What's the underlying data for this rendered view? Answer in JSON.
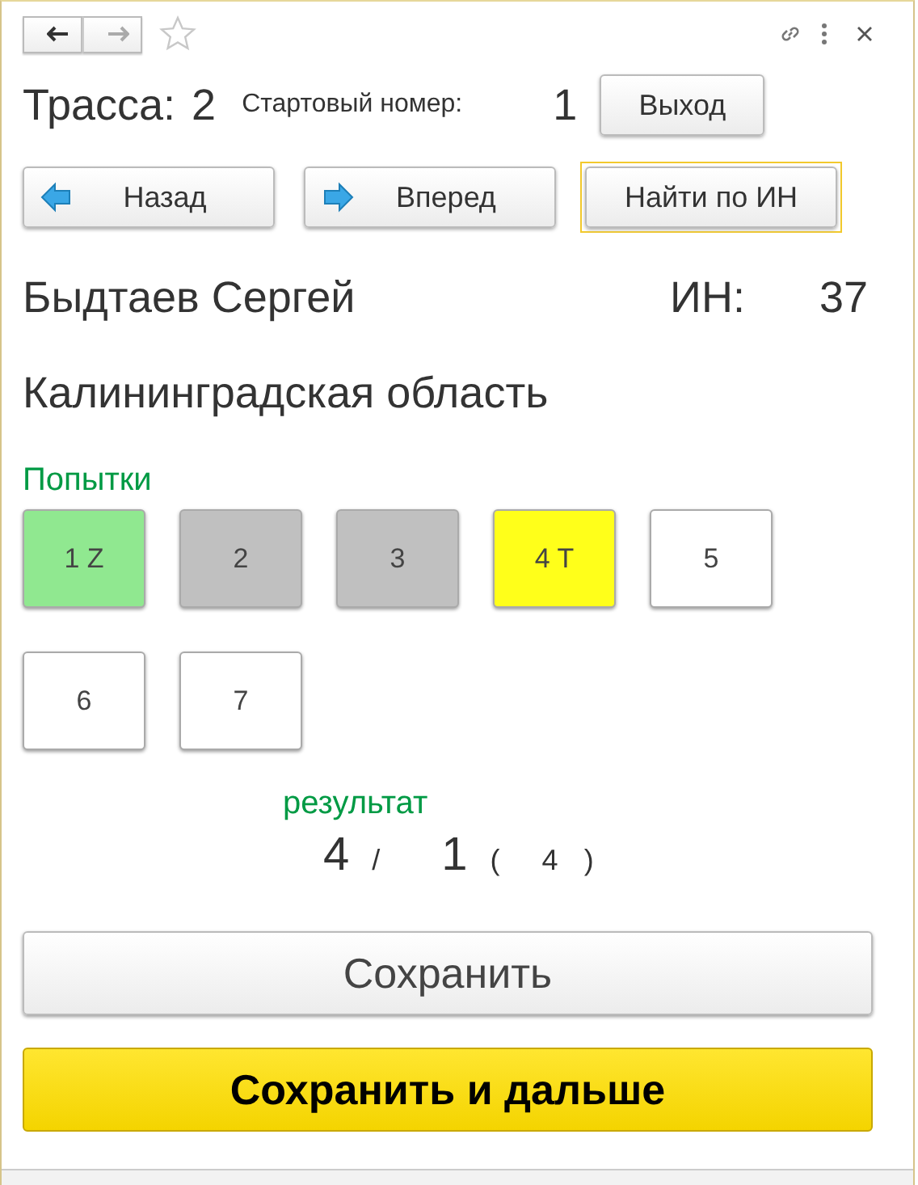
{
  "nav": [
    {
      "kind": "back",
      "disabled": false
    },
    {
      "kind": "forward",
      "disabled": true
    }
  ],
  "header": {
    "track_label": "Трасса:",
    "track": "2",
    "start_label": "Стартовый номер:",
    "start_number": "1",
    "exit_button": "Выход"
  },
  "nav_buttons": [
    {
      "kind": "back",
      "label": "Назад",
      "focused": false
    },
    {
      "kind": "forward",
      "label": "Вперед",
      "focused": false
    },
    {
      "kind": "none",
      "label": "Найти по ИН",
      "focused": true
    }
  ],
  "athlete": {
    "name": "Быдтаев Сергей",
    "id_label": "ИН:",
    "id": "37",
    "region": "Калининградская область"
  },
  "attempts_label": "Попытки",
  "attempts": [
    {
      "label": "1 Z",
      "color": "#90e890"
    },
    {
      "label": "2",
      "color": "#c0c0c0"
    },
    {
      "label": "3",
      "color": "#c0c0c0"
    },
    {
      "label": "4 T",
      "color": "#ffff1a"
    },
    {
      "label": "5",
      "color": "#ffffff"
    },
    {
      "label": "6",
      "color": "#ffffff"
    },
    {
      "label": "7",
      "color": "#ffffff"
    }
  ],
  "result": {
    "label": "результат",
    "value_1": "4",
    "separator": "/",
    "value_2": "1",
    "open_paren": "(",
    "value_3": "4",
    "close_paren": ")"
  },
  "buttons": [
    {
      "kind": "plain",
      "label": "Сохранить"
    },
    {
      "kind": "primary",
      "label": "Сохранить и дальше"
    }
  ]
}
